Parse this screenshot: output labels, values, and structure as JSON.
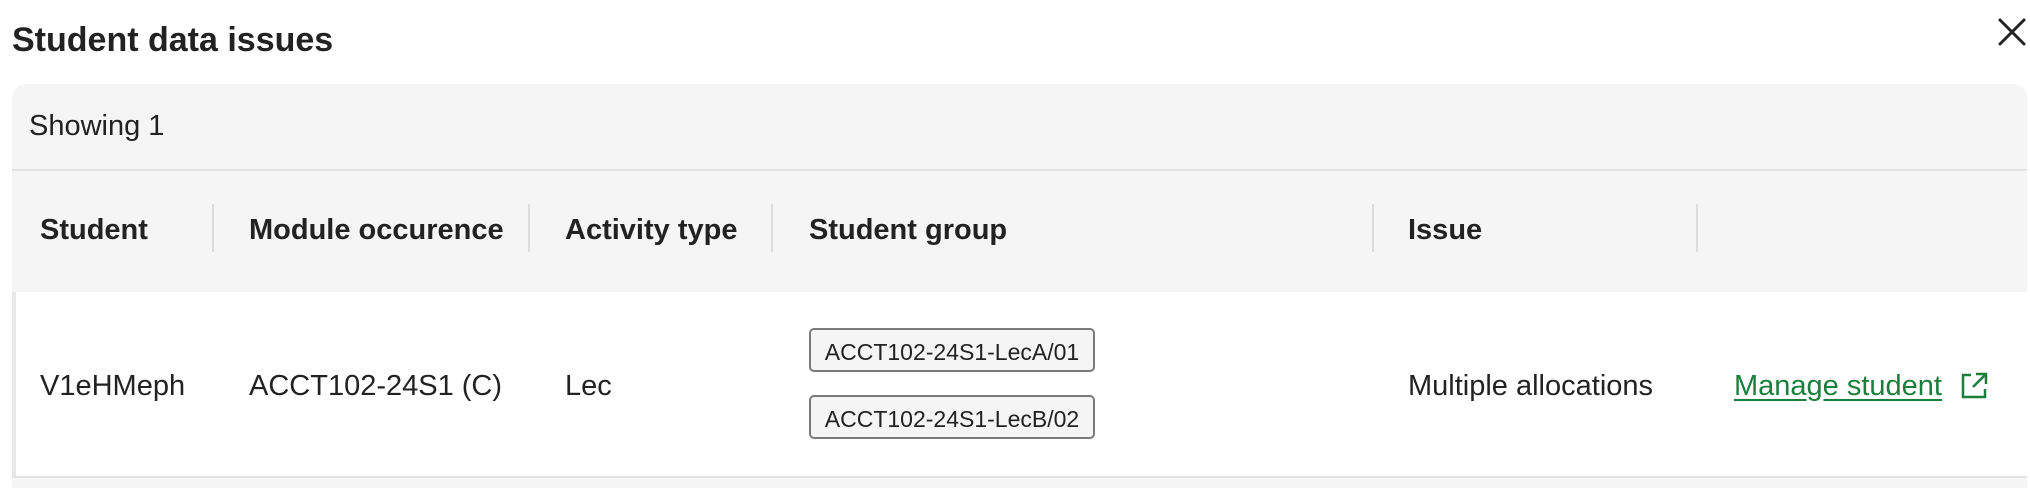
{
  "dialog": {
    "title": "Student data issues",
    "close_icon": "close-icon"
  },
  "summary": {
    "showing": "Showing 1"
  },
  "table": {
    "columns": [
      "Student",
      "Module occurence",
      "Activity type",
      "Student group",
      "Issue",
      ""
    ],
    "rows": [
      {
        "student": "V1eHMeph",
        "module_occurrence": "ACCT102-24S1 (C)",
        "activity_type": "Lec",
        "student_groups": [
          "ACCT102-24S1-LecA/01",
          "ACCT102-24S1-LecB/02"
        ],
        "issue": "Multiple allocations",
        "action_label": "Manage student",
        "action_icon": "external-link-icon"
      }
    ]
  },
  "colors": {
    "link": "#1a7f3c",
    "panel_bg": "#f5f5f5",
    "border": "#e3e3e3"
  }
}
